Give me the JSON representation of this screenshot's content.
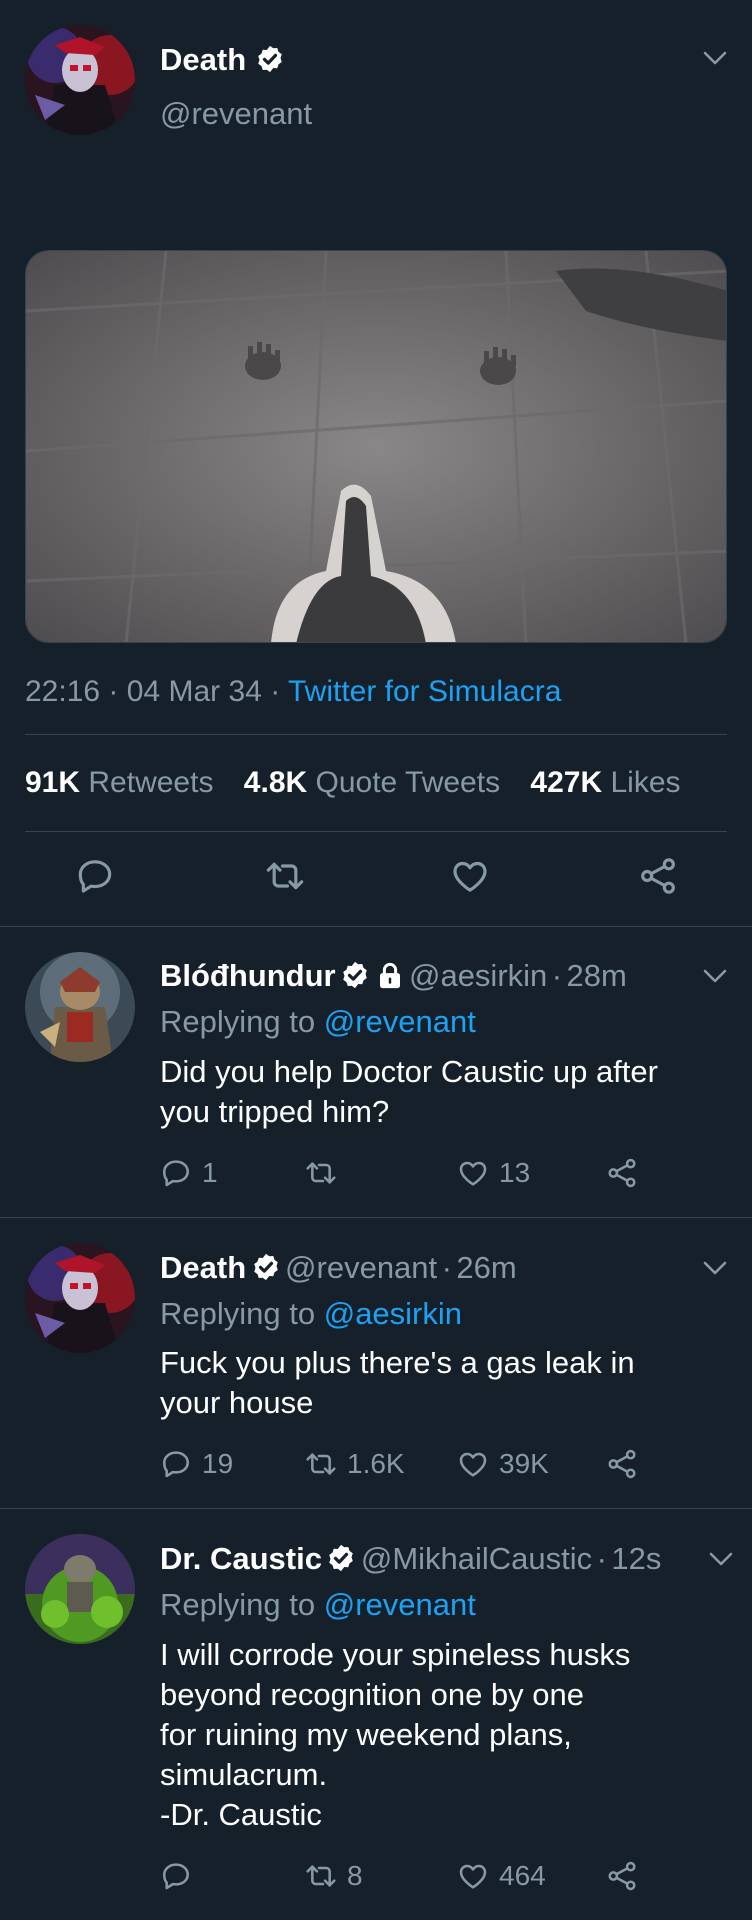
{
  "main_tweet": {
    "name": "Death",
    "handle": "@revenant",
    "time": "22:16",
    "date": "04 Mar 34",
    "client": "Twitter for Simulacra",
    "stats": {
      "retweets_count": "91K",
      "retweets_label": "Retweets",
      "quotes_count": "4.8K",
      "quotes_label": "Quote Tweets",
      "likes_count": "427K",
      "likes_label": "Likes"
    }
  },
  "replies": [
    {
      "name": "Blóđhundur",
      "handle": "@aesirkin",
      "time": "28m",
      "replying_prefix": "Replying to",
      "replying_to": "@revenant",
      "text_lines": [
        "Did you help Doctor Caustic up after",
        "you tripped him?"
      ],
      "reply_count": "1",
      "retweet_count": "",
      "like_count": "13"
    },
    {
      "name": "Death",
      "handle": "@revenant",
      "time": "26m",
      "replying_prefix": "Replying to",
      "replying_to": "@aesirkin",
      "text_lines": [
        "Fuck you plus there's a gas leak in",
        "your house"
      ],
      "reply_count": "19",
      "retweet_count": "1.6K",
      "like_count": "39K"
    },
    {
      "name": "Dr. Caustic",
      "handle": "@MikhailCaustic",
      "time": "12s",
      "replying_prefix": "Replying to",
      "replying_to": "@revenant",
      "text_lines": [
        "I will corrode your spineless husks",
        "beyond recognition one by one",
        "for ruining my weekend plans,",
        "simulacrum.",
        "-Dr. Caustic"
      ],
      "reply_count": "",
      "retweet_count": "8",
      "like_count": "464"
    }
  ],
  "separator": "·",
  "colors": {
    "background": "#15202b",
    "accent": "#1da1f2",
    "muted": "#8899a6",
    "divider": "#38444d"
  },
  "icons": [
    "verified-badge-icon",
    "lock-icon",
    "chevron-down-icon",
    "reply-icon",
    "retweet-icon",
    "like-icon",
    "share-icon"
  ]
}
